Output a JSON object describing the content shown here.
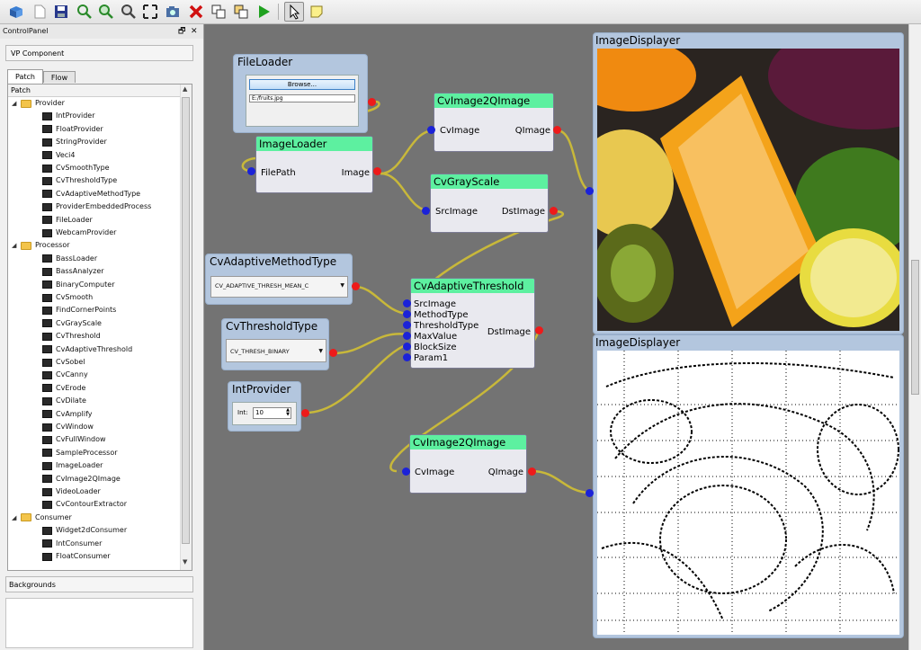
{
  "toolbar": {
    "icons": [
      "open-icon",
      "new-icon",
      "save-icon",
      "zoom-fit-icon",
      "zoom-in-icon",
      "zoom-out-icon",
      "fullscreen-icon",
      "screenshot-icon",
      "delete-icon",
      "copy-icon",
      "paste-icon",
      "run-icon",
      "pointer-icon",
      "note-icon"
    ]
  },
  "control_panel": {
    "title": "ControlPanel",
    "float_btn": "🗗",
    "close_btn": "✕",
    "vp_component": "VP Component",
    "tabs": [
      "Patch",
      "Flow"
    ],
    "tree_header": "Patch",
    "categories": [
      {
        "name": "Provider",
        "items": [
          "IntProvider",
          "FloatProvider",
          "StringProvider",
          "Veci4",
          "CvSmoothType",
          "CvThresholdType",
          "CvAdaptiveMethodType",
          "ProviderEmbeddedProcess",
          "FileLoader",
          "WebcamProvider"
        ]
      },
      {
        "name": "Processor",
        "items": [
          "BassLoader",
          "BassAnalyzer",
          "BinaryComputer",
          "CvSmooth",
          "FindCornerPoints",
          "CvGrayScale",
          "CvThreshold",
          "CvAdaptiveThreshold",
          "CvSobel",
          "CvCanny",
          "CvErode",
          "CvDilate",
          "CvAmplify",
          "CvWindow",
          "CvFullWindow",
          "SampleProcessor",
          "ImageLoader",
          "CvImage2QImage",
          "VideoLoader",
          "CvContourExtractor"
        ]
      },
      {
        "name": "Consumer",
        "items": [
          "Widget2dConsumer",
          "IntConsumer",
          "FloatConsumer"
        ]
      }
    ],
    "backgrounds_label": "Backgrounds"
  },
  "canvas": {
    "fileloader": {
      "title": "FileLoader",
      "browse": "Browse...",
      "path": "E:/fruits.jpg"
    },
    "imageloader": {
      "title": "ImageLoader",
      "in": "FilePath",
      "out": "Image"
    },
    "cvimage2qimage_1": {
      "title": "CvImage2QImage",
      "in": "CvImage",
      "out": "QImage"
    },
    "cvgrayscale": {
      "title": "CvGrayScale",
      "in": "SrcImage",
      "out": "DstImage"
    },
    "cvadaptivemethodtype": {
      "title": "CvAdaptiveMethodType",
      "value": "CV_ADAPTIVE_THRESH_MEAN_C"
    },
    "cvthresholdtype": {
      "title": "CvThresholdType",
      "value": "CV_THRESH_BINARY"
    },
    "intprovider": {
      "title": "IntProvider",
      "label": "Int:",
      "value": "10"
    },
    "cvadaptivethreshold": {
      "title": "CvAdaptiveThreshold",
      "ins": [
        "SrcImage",
        "MethodType",
        "ThresholdType",
        "MaxValue",
        "BlockSize",
        "Param1"
      ],
      "out": "DstImage"
    },
    "cvimage2qimage_2": {
      "title": "CvImage2QImage",
      "in": "CvImage",
      "out": "QImage"
    },
    "imagedisplayer_1": {
      "title": "ImageDisplayer"
    },
    "imagedisplayer_2": {
      "title": "ImageDisplayer"
    }
  },
  "colors": {
    "canvas_bg": "#737373",
    "node_header": "#5df0a0",
    "output_port": "#ee1a1a",
    "input_port": "#1b22d8",
    "wire": "#c8b83a",
    "provider_frame": "#b3c6de"
  }
}
